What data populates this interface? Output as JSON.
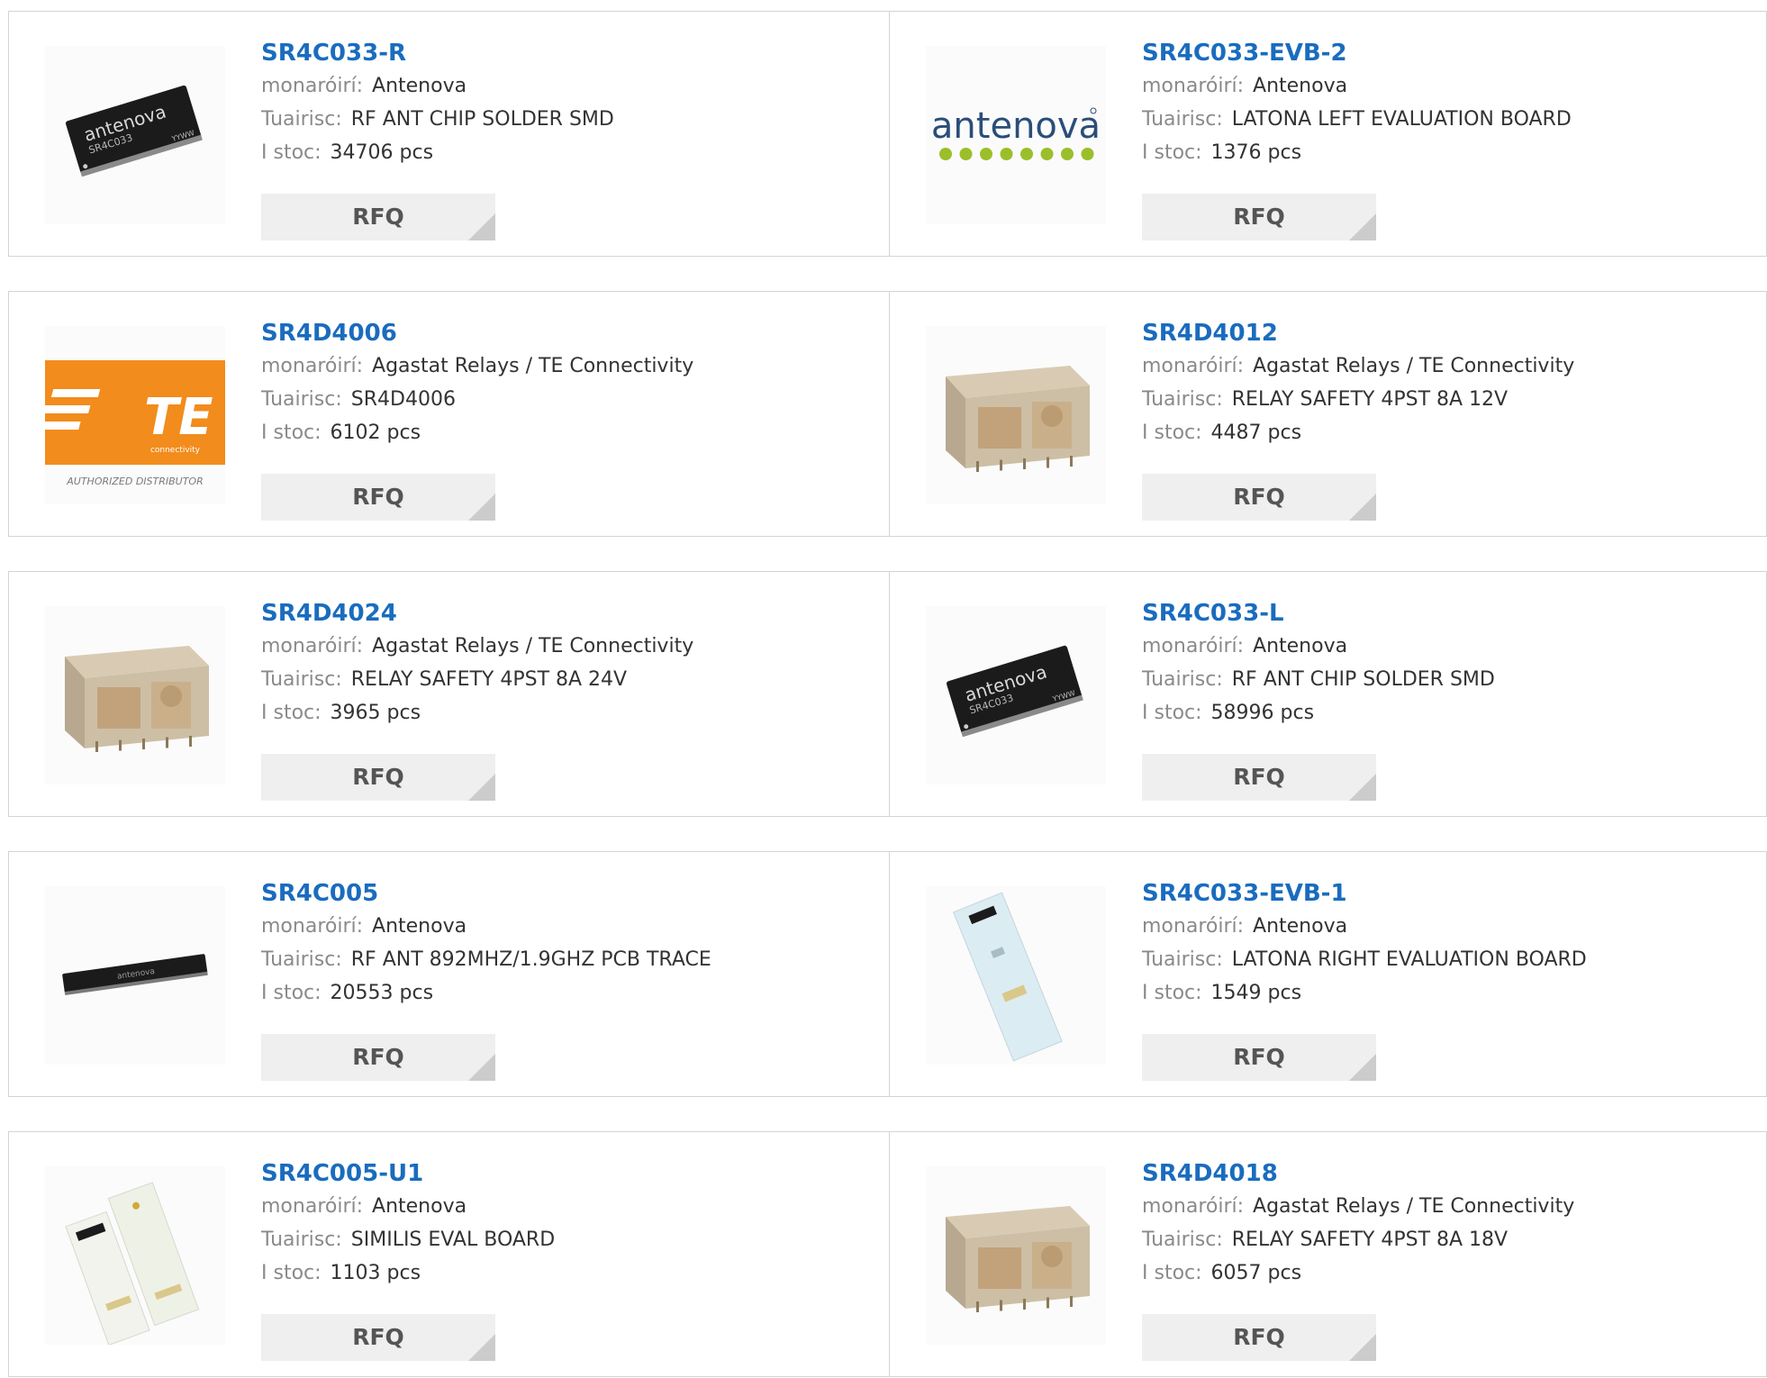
{
  "labels": {
    "manufacturer": "monaróirí:",
    "description": "Tuairisc:",
    "stock": "I stoc:",
    "rfq": "RFQ"
  },
  "products": [
    {
      "part": "SR4C033-R",
      "manufacturer": "Antenova",
      "description": "RF ANT CHIP SOLDER SMD",
      "stock": "34706 pcs",
      "image": "antenova-chip-icon",
      "logo_text": "antenova",
      "chip_text": "SR4C033",
      "chip_text_2": "YYWW"
    },
    {
      "part": "SR4C033-EVB-2",
      "manufacturer": "Antenova",
      "description": "LATONA LEFT EVALUATION BOARD",
      "stock": "1376 pcs",
      "image": "antenova-logo-icon",
      "logo_text": "antenova"
    },
    {
      "part": "SR4D4006",
      "manufacturer": "Agastat Relays / TE Connectivity",
      "description": "SR4D4006",
      "stock": "6102 pcs",
      "image": "te-logo-icon",
      "logo_text": "TE",
      "logo_sub": "connectivity",
      "logo_caption": "AUTHORIZED DISTRIBUTOR"
    },
    {
      "part": "SR4D4012",
      "manufacturer": "Agastat Relays / TE Connectivity",
      "description": "RELAY SAFETY 4PST 8A 12V",
      "stock": "4487 pcs",
      "image": "relay-icon"
    },
    {
      "part": "SR4D4024",
      "manufacturer": "Agastat Relays / TE Connectivity",
      "description": "RELAY SAFETY 4PST 8A 24V",
      "stock": "3965 pcs",
      "image": "relay-icon"
    },
    {
      "part": "SR4C033-L",
      "manufacturer": "Antenova",
      "description": "RF ANT CHIP SOLDER SMD",
      "stock": "58996 pcs",
      "image": "antenova-chip-icon",
      "logo_text": "antenova",
      "chip_text": "SR4C033",
      "chip_text_2": "YYWW"
    },
    {
      "part": "SR4C005",
      "manufacturer": "Antenova",
      "description": "RF ANT 892MHZ/1.9GHZ PCB TRACE",
      "stock": "20553 pcs",
      "image": "antenova-long-chip-icon",
      "logo_text": "antenova"
    },
    {
      "part": "SR4C033-EVB-1",
      "manufacturer": "Antenova",
      "description": "LATONA RIGHT EVALUATION BOARD",
      "stock": "1549 pcs",
      "image": "eval-board-icon"
    },
    {
      "part": "SR4C005-U1",
      "manufacturer": "Antenova",
      "description": "SIMILIS EVAL BOARD",
      "stock": "1103 pcs",
      "image": "eval-board-pair-icon"
    },
    {
      "part": "SR4D4018",
      "manufacturer": "Agastat Relays / TE Connectivity",
      "description": "RELAY SAFETY 4PST 8A 18V",
      "stock": "6057 pcs",
      "image": "relay-icon"
    }
  ],
  "colors": {
    "part_link": "#1a6cbe",
    "label": "#8a8a8a",
    "value": "#333333",
    "rfq_bg": "#efefef",
    "border": "#d4d4d4",
    "te_orange": "#f28c1c",
    "antenova_blue": "#2a4e7a",
    "antenova_dots": "#9bbf2a"
  }
}
